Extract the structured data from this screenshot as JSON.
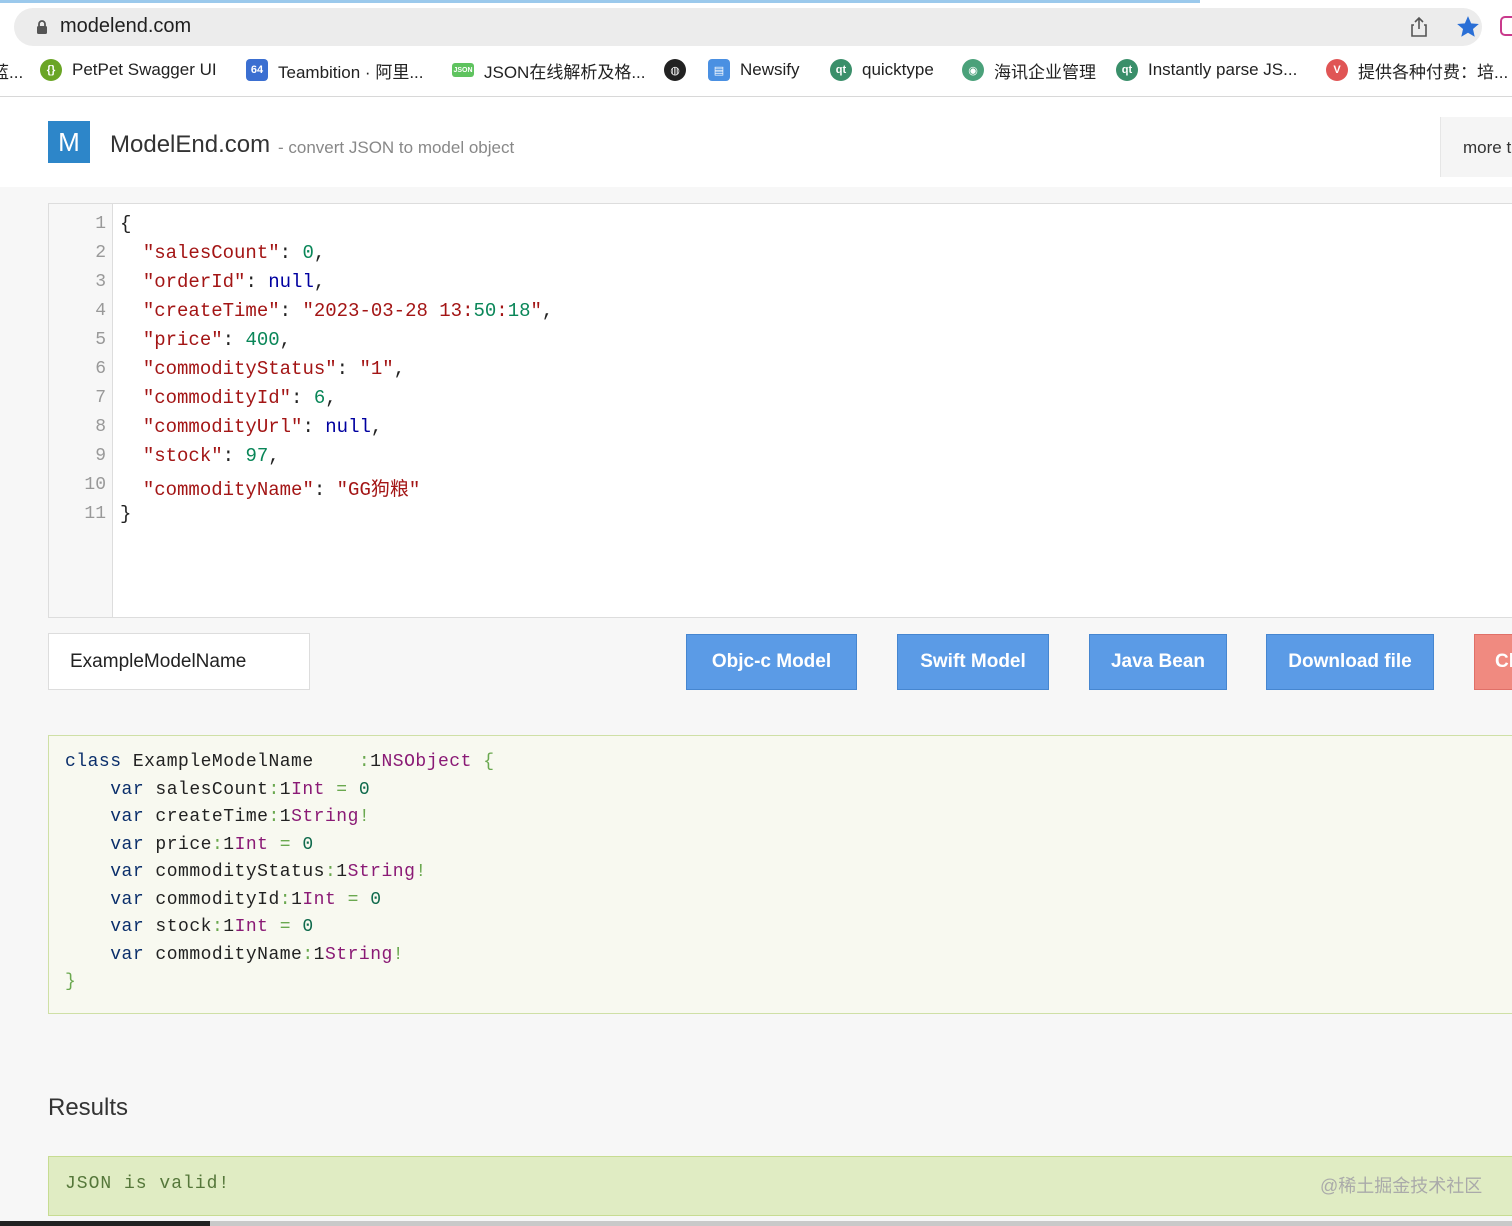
{
  "browser": {
    "url": "modelend.com",
    "icons": {
      "lock": "lock-icon",
      "share": "share-icon",
      "star": "bookmark-star-icon"
    }
  },
  "bookmarks": [
    {
      "label": "蓝...",
      "icon_color": "#888888"
    },
    {
      "label": "PetPet Swagger UI",
      "icon_color": "#6aa525"
    },
    {
      "label": "Teambition · 阿里...",
      "icon_color": "#d9483b"
    },
    {
      "label": "JSON在线解析及格...",
      "icon_color": "#5fc35f"
    },
    {
      "label": "",
      "icon_color": "#222222"
    },
    {
      "label": "Newsify",
      "icon_color": "#4a90e2"
    },
    {
      "label": "quicktype",
      "icon_color": "#3a8f6a"
    },
    {
      "label": "海讯企业管理",
      "icon_color": "#4aa17a"
    },
    {
      "label": "Instantly parse JS...",
      "icon_color": "#3a8f6a"
    },
    {
      "label": "提供各种付费：培...",
      "icon_color": "#e05555"
    }
  ],
  "header": {
    "logo_letter": "M",
    "site_name": "ModelEnd.com",
    "tagline": "- convert JSON to model object",
    "more": "more t"
  },
  "editor": {
    "line_numbers": [
      "1",
      "2",
      "3",
      "4",
      "5",
      "6",
      "7",
      "8",
      "9",
      "10",
      "11"
    ],
    "lines": [
      "{",
      "  \"salesCount\": 0,",
      "  \"orderId\": null,",
      "  \"createTime\": \"2023-03-28 13:50:18\",",
      "  \"price\": 400,",
      "  \"commodityStatus\": \"1\",",
      "  \"commodityId\": 6,",
      "  \"commodityUrl\": null,",
      "  \"stock\": 97,",
      "  \"commodityName\": \"GG狗粮\"",
      "}"
    ]
  },
  "controls": {
    "model_name_value": "ExampleModelName",
    "buttons": [
      "Objc-c Model",
      "Swift Model",
      "Java Bean",
      "Download file",
      "Cl"
    ]
  },
  "output": {
    "lines": [
      "class ExampleModelName    : NSObject {",
      "    var salesCount: Int = 0",
      "    var createTime: String!",
      "    var price: Int = 0",
      "    var commodityStatus: String!",
      "    var commodityId: Int = 0",
      "    var stock: Int = 0",
      "    var commodityName: String!",
      "}"
    ]
  },
  "results": {
    "title": "Results",
    "message": "JSON is valid!",
    "watermark": "@稀土掘金技术社区"
  },
  "colors": {
    "accent_button": "#5b9be6",
    "logo": "#2d86c9",
    "clear_button": "#f08a80"
  }
}
